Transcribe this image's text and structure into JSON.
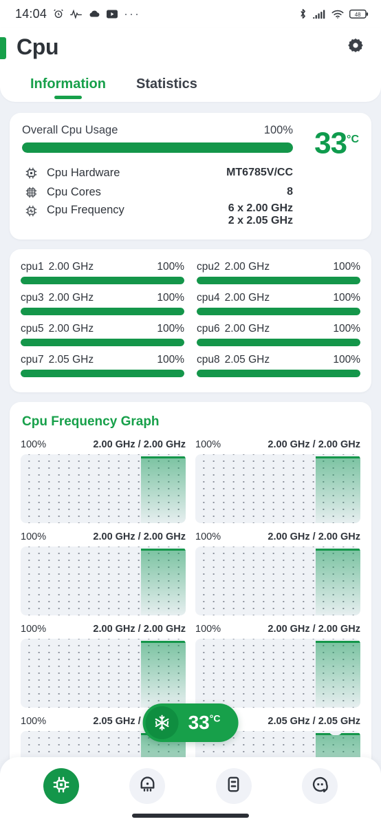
{
  "statusbar": {
    "time": "14:04",
    "left_icons": [
      "alarm-clock-icon",
      "waveform-icon",
      "cloud-icon",
      "youtube-icon",
      "more-dots-icon"
    ],
    "right_icons": [
      "bluetooth-icon",
      "signal-icon",
      "wifi-icon",
      "battery-icon"
    ],
    "battery_level": "48"
  },
  "header": {
    "title": "Cpu",
    "settings_icon": "gear-icon",
    "accent_color": "#17a04a",
    "tabs": [
      {
        "label": "Information",
        "active": true
      },
      {
        "label": "Statistics",
        "active": false
      }
    ]
  },
  "overview": {
    "usage_label": "Overall Cpu Usage",
    "usage_percent": "100%",
    "usage_value": 100,
    "temperature": "33",
    "temperature_unit": "°C",
    "rows": [
      {
        "icon": "cpu-chip-icon",
        "name": "Cpu Hardware",
        "value": "MT6785V/CC",
        "value2": ""
      },
      {
        "icon": "cpu-cores-icon",
        "name": "Cpu Cores",
        "value": "8",
        "value2": ""
      },
      {
        "icon": "cpu-frequency-icon",
        "name": "Cpu Frequency",
        "value": "6 x 2.00 GHz",
        "value2": "2 x 2.05 GHz"
      }
    ]
  },
  "cores": [
    {
      "name": "cpu1",
      "freq": "2.00 GHz",
      "percent": "100%",
      "value": 100
    },
    {
      "name": "cpu2",
      "freq": "2.00 GHz",
      "percent": "100%",
      "value": 100
    },
    {
      "name": "cpu3",
      "freq": "2.00 GHz",
      "percent": "100%",
      "value": 100
    },
    {
      "name": "cpu4",
      "freq": "2.00 GHz",
      "percent": "100%",
      "value": 100
    },
    {
      "name": "cpu5",
      "freq": "2.00 GHz",
      "percent": "100%",
      "value": 100
    },
    {
      "name": "cpu6",
      "freq": "2.00 GHz",
      "percent": "100%",
      "value": 100
    },
    {
      "name": "cpu7",
      "freq": "2.05 GHz",
      "percent": "100%",
      "value": 100
    },
    {
      "name": "cpu8",
      "freq": "2.05 GHz",
      "percent": "100%",
      "value": 100
    }
  ],
  "frequency_graph": {
    "title": "Cpu Frequency Graph",
    "items": [
      {
        "percent": "100%",
        "freq": "2.00 GHz / 2.00 GHz",
        "fill_width": 27,
        "notch": false
      },
      {
        "percent": "100%",
        "freq": "2.00 GHz / 2.00 GHz",
        "fill_width": 27,
        "notch": false
      },
      {
        "percent": "100%",
        "freq": "2.00 GHz / 2.00 GHz",
        "fill_width": 27,
        "notch": false
      },
      {
        "percent": "100%",
        "freq": "2.00 GHz / 2.00 GHz",
        "fill_width": 27,
        "notch": false
      },
      {
        "percent": "100%",
        "freq": "2.00 GHz / 2.00 GHz",
        "fill_width": 27,
        "notch": false
      },
      {
        "percent": "100%",
        "freq": "2.00 GHz / 2.00 GHz",
        "fill_width": 27,
        "notch": false
      },
      {
        "percent": "100%",
        "freq": "2.05 GHz / 2.05 GHz",
        "fill_width": 27,
        "notch": false
      },
      {
        "percent": "100%",
        "freq": "2.05 GHz / 2.05 GHz",
        "fill_width": 27,
        "notch": true
      }
    ]
  },
  "chart_data": {
    "type": "area",
    "title": "Cpu Frequency Graph",
    "ylabel": "100%",
    "ylim": [
      0,
      100
    ],
    "grid": "dotted",
    "series": [
      {
        "name": "cpu1",
        "current_freq": "2.00 GHz",
        "max_freq": "2.00 GHz",
        "usage_percent": 100,
        "samples": [
          0,
          0,
          0,
          0,
          0,
          0,
          0,
          0,
          0,
          0,
          0,
          0,
          100,
          100,
          100,
          100,
          100
        ]
      },
      {
        "name": "cpu2",
        "current_freq": "2.00 GHz",
        "max_freq": "2.00 GHz",
        "usage_percent": 100,
        "samples": [
          0,
          0,
          0,
          0,
          0,
          0,
          0,
          0,
          0,
          0,
          0,
          0,
          100,
          100,
          100,
          100,
          100
        ]
      },
      {
        "name": "cpu3",
        "current_freq": "2.00 GHz",
        "max_freq": "2.00 GHz",
        "usage_percent": 100,
        "samples": [
          0,
          0,
          0,
          0,
          0,
          0,
          0,
          0,
          0,
          0,
          0,
          0,
          100,
          100,
          100,
          100,
          100
        ]
      },
      {
        "name": "cpu4",
        "current_freq": "2.00 GHz",
        "max_freq": "2.00 GHz",
        "usage_percent": 100,
        "samples": [
          0,
          0,
          0,
          0,
          0,
          0,
          0,
          0,
          0,
          0,
          0,
          0,
          100,
          100,
          100,
          100,
          100
        ]
      },
      {
        "name": "cpu5",
        "current_freq": "2.00 GHz",
        "max_freq": "2.00 GHz",
        "usage_percent": 100,
        "samples": [
          0,
          0,
          0,
          0,
          0,
          0,
          0,
          0,
          0,
          0,
          0,
          0,
          100,
          100,
          100,
          100,
          100
        ]
      },
      {
        "name": "cpu6",
        "current_freq": "2.00 GHz",
        "max_freq": "2.00 GHz",
        "usage_percent": 100,
        "samples": [
          0,
          0,
          0,
          0,
          0,
          0,
          0,
          0,
          0,
          0,
          0,
          0,
          100,
          100,
          100,
          100,
          100
        ]
      },
      {
        "name": "cpu7",
        "current_freq": "2.05 GHz",
        "max_freq": "2.05 GHz",
        "usage_percent": 100,
        "samples": [
          0,
          0,
          0,
          0,
          0,
          0,
          0,
          0,
          0,
          0,
          0,
          0,
          100,
          100,
          100,
          100,
          100
        ]
      },
      {
        "name": "cpu8",
        "current_freq": "2.05 GHz",
        "max_freq": "2.05 GHz",
        "usage_percent": 100,
        "samples": [
          0,
          0,
          0,
          0,
          0,
          0,
          0,
          0,
          0,
          0,
          0,
          0,
          100,
          95,
          100,
          100,
          100
        ]
      }
    ]
  },
  "float_pill": {
    "icon": "snowflake-icon",
    "temperature": "33",
    "unit": "°C"
  },
  "bottomnav": [
    {
      "icon": "cpu-chip-icon",
      "active": true
    },
    {
      "icon": "ram-memory-icon",
      "active": false
    },
    {
      "icon": "battery-storage-icon",
      "active": false
    },
    {
      "icon": "chat-bubble-icon",
      "active": false
    }
  ]
}
